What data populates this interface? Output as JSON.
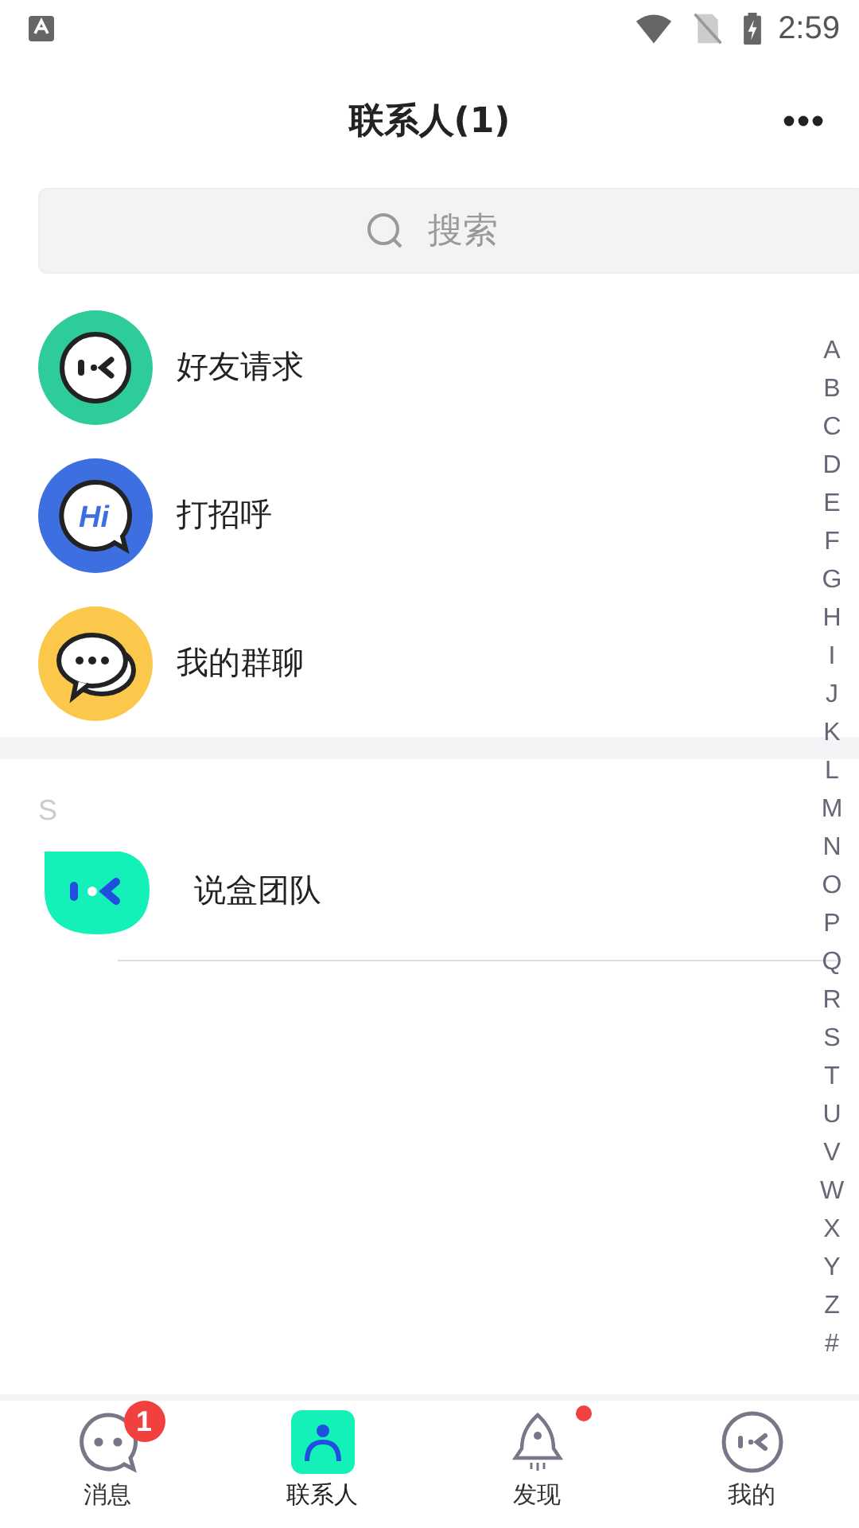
{
  "status_bar": {
    "time": "2:59"
  },
  "header": {
    "title": "联系人(1)"
  },
  "search": {
    "placeholder": "搜索"
  },
  "shortcuts": [
    {
      "kind": "request",
      "label": "好友请求"
    },
    {
      "kind": "greet",
      "label": "打招呼",
      "icon_text": "Hi"
    },
    {
      "kind": "groups",
      "label": "我的群聊"
    }
  ],
  "sections": [
    {
      "letter": "S",
      "contacts": [
        {
          "name": "说盒团队"
        }
      ]
    }
  ],
  "index": [
    "A",
    "B",
    "C",
    "D",
    "E",
    "F",
    "G",
    "H",
    "I",
    "J",
    "K",
    "L",
    "M",
    "N",
    "O",
    "P",
    "Q",
    "R",
    "S",
    "T",
    "U",
    "V",
    "W",
    "X",
    "Y",
    "Z",
    "#"
  ],
  "tabs": [
    {
      "kind": "messages",
      "label": "消息",
      "selected": false,
      "badge": "1",
      "dot": false
    },
    {
      "kind": "contacts",
      "label": "联系人",
      "selected": true,
      "dot": false
    },
    {
      "kind": "discover",
      "label": "发现",
      "selected": false,
      "dot": true
    },
    {
      "kind": "me",
      "label": "我的",
      "selected": false,
      "dot": false
    }
  ]
}
